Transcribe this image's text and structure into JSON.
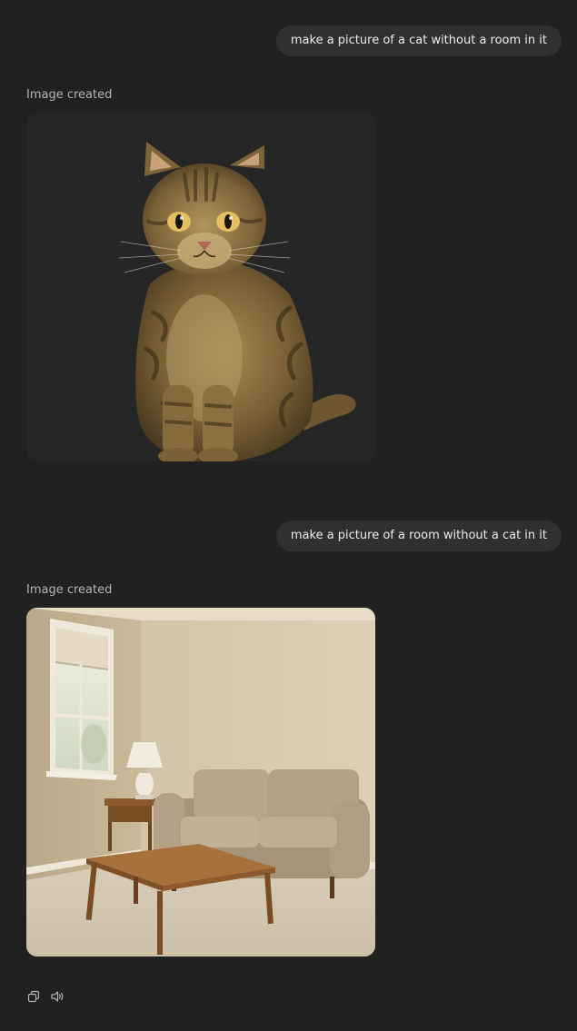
{
  "messages": [
    {
      "role": "user",
      "text": "make a picture of a cat without a room in it"
    },
    {
      "role": "assistant",
      "status": "Image created",
      "image_subject": "tabby cat on dark background"
    },
    {
      "role": "user",
      "text": "make a picture of a room without a cat in it"
    },
    {
      "role": "assistant",
      "status": "Image created",
      "image_subject": "empty living room with sofa, lamp and coffee table"
    }
  ],
  "actions": [
    {
      "name": "copy",
      "icon": "copy-icon"
    },
    {
      "name": "read-aloud",
      "icon": "speaker-icon"
    }
  ]
}
